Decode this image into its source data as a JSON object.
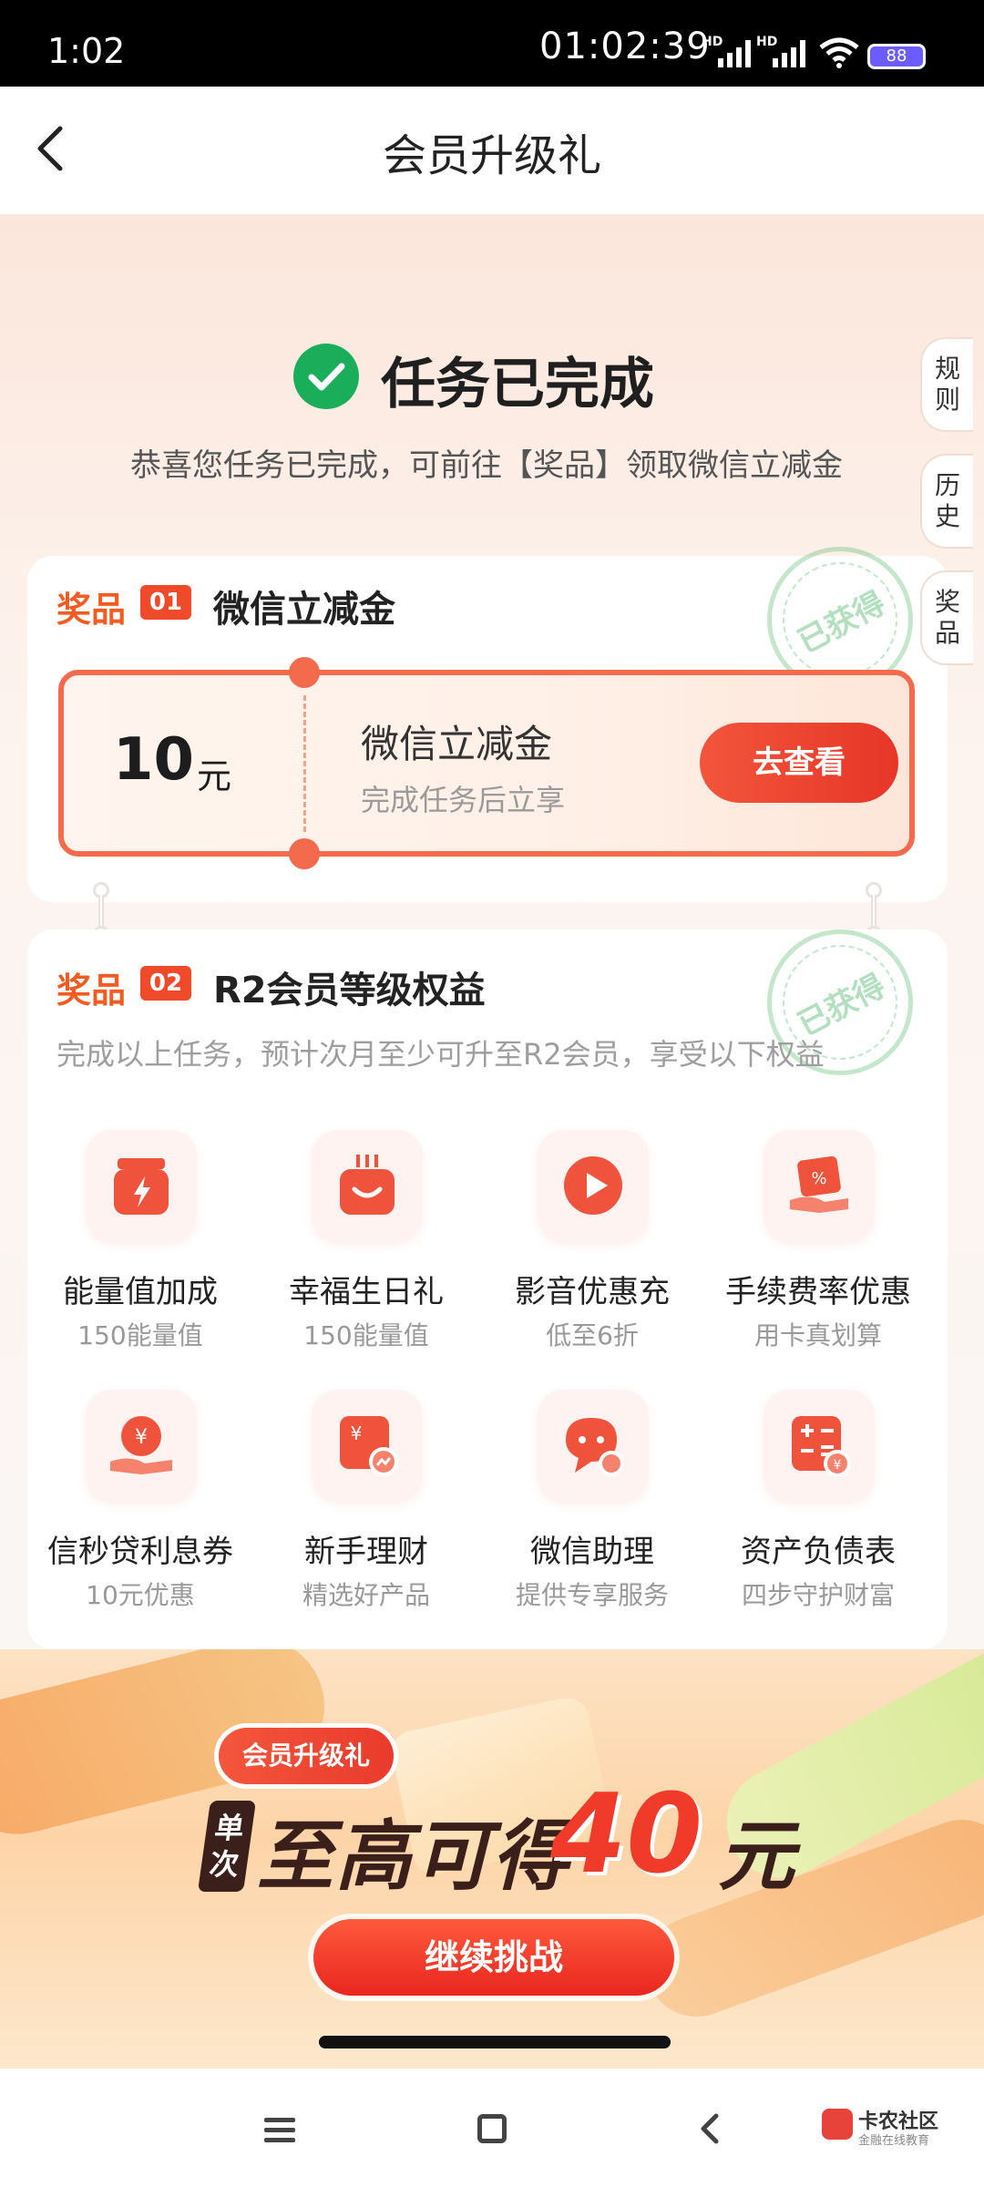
{
  "status_bar": {
    "time": "1:02",
    "clock": "01:02:39",
    "signal_label": "HD",
    "battery": "88"
  },
  "nav": {
    "title": "会员升级礼"
  },
  "task": {
    "headline": "任务已完成",
    "subline": "恭喜您任务已完成，可前往【奖品】领取微信立减金"
  },
  "side_tabs": [
    {
      "label": "规则",
      "chars": [
        "规",
        "则"
      ]
    },
    {
      "label": "历史",
      "chars": [
        "历",
        "史"
      ]
    },
    {
      "label": "奖品",
      "chars": [
        "奖",
        "品"
      ]
    }
  ],
  "prizes": [
    {
      "label": "奖品",
      "num": "01",
      "title": "微信立减金",
      "stamp": "已获得",
      "coupon": {
        "amount": "10",
        "unit": "元",
        "title": "微信立减金",
        "subtitle": "完成任务后立享",
        "button": "去查看"
      }
    },
    {
      "label": "奖品",
      "num": "02",
      "title": "R2会员等级权益",
      "stamp": "已获得",
      "description": "完成以上任务，预计次月至少可升至R2会员，享受以下权益"
    }
  ],
  "benefits": [
    {
      "title": "能量值加成",
      "subtitle": "150能量值",
      "icon": "energy-jar-icon"
    },
    {
      "title": "幸福生日礼",
      "subtitle": "150能量值",
      "icon": "birthday-cake-icon"
    },
    {
      "title": "影音优惠充",
      "subtitle": "低至6折",
      "icon": "play-icon"
    },
    {
      "title": "手续费率优惠",
      "subtitle": "用卡真划算",
      "icon": "fee-discount-icon"
    },
    {
      "title": "信秒贷利息券",
      "subtitle": "10元优惠",
      "icon": "yen-coin-hand-icon"
    },
    {
      "title": "新手理财",
      "subtitle": "精选好产品",
      "icon": "yen-chart-icon"
    },
    {
      "title": "微信助理",
      "subtitle": "提供专享服务",
      "icon": "chat-assistant-icon"
    },
    {
      "title": "资产负债表",
      "subtitle": "四步守护财富",
      "icon": "calculator-yen-icon"
    }
  ],
  "banner": {
    "tag": "会员升级礼",
    "badge": [
      "单",
      "次"
    ],
    "slogan": "至高可得",
    "amount": "40",
    "unit": "元",
    "cta": "继续挑战"
  },
  "watermark": {
    "name": "卡农社区",
    "tagline": "金融在线教育"
  },
  "colors": {
    "accent": "#f25c22",
    "button_red": "#e63628",
    "success_green": "#1aae5a"
  }
}
